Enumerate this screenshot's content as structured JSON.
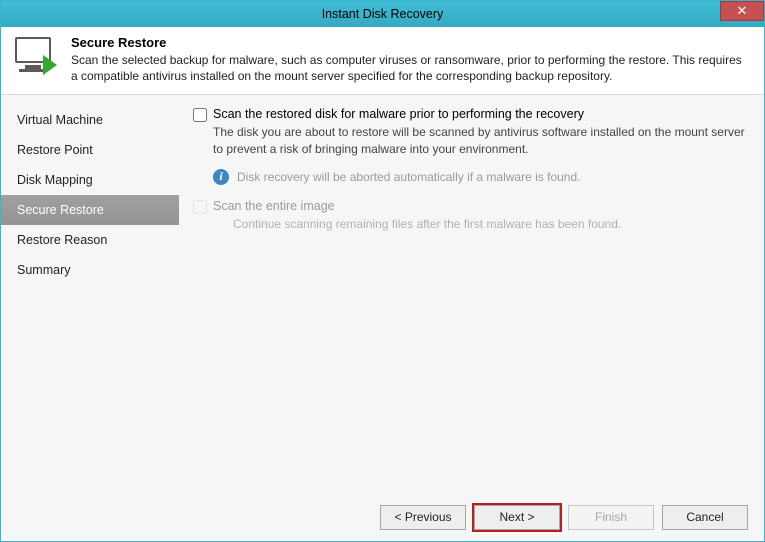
{
  "window": {
    "title": "Instant Disk Recovery"
  },
  "header": {
    "title": "Secure Restore",
    "desc": "Scan the selected backup for malware, such as computer viruses or ransomware, prior to performing the restore. This requires a compatible antivirus installed on the mount server specified for the corresponding backup repository."
  },
  "sidebar": {
    "items": [
      "Virtual Machine",
      "Restore Point",
      "Disk Mapping",
      "Secure Restore",
      "Restore Reason",
      "Summary"
    ],
    "active_index": 3
  },
  "content": {
    "scan_checkbox_label": "Scan the restored disk for malware prior to performing the recovery",
    "scan_desc": "The disk you are about to restore will be scanned by antivirus software installed on the mount server to prevent a risk of bringing malware into your environment.",
    "info_text": "Disk recovery will be aborted automatically if a malware is found.",
    "entire_checkbox_label": "Scan the entire image",
    "entire_desc": "Continue scanning remaining files after the first malware has been found."
  },
  "buttons": {
    "previous": "< Previous",
    "next": "Next >",
    "finish": "Finish",
    "cancel": "Cancel"
  }
}
